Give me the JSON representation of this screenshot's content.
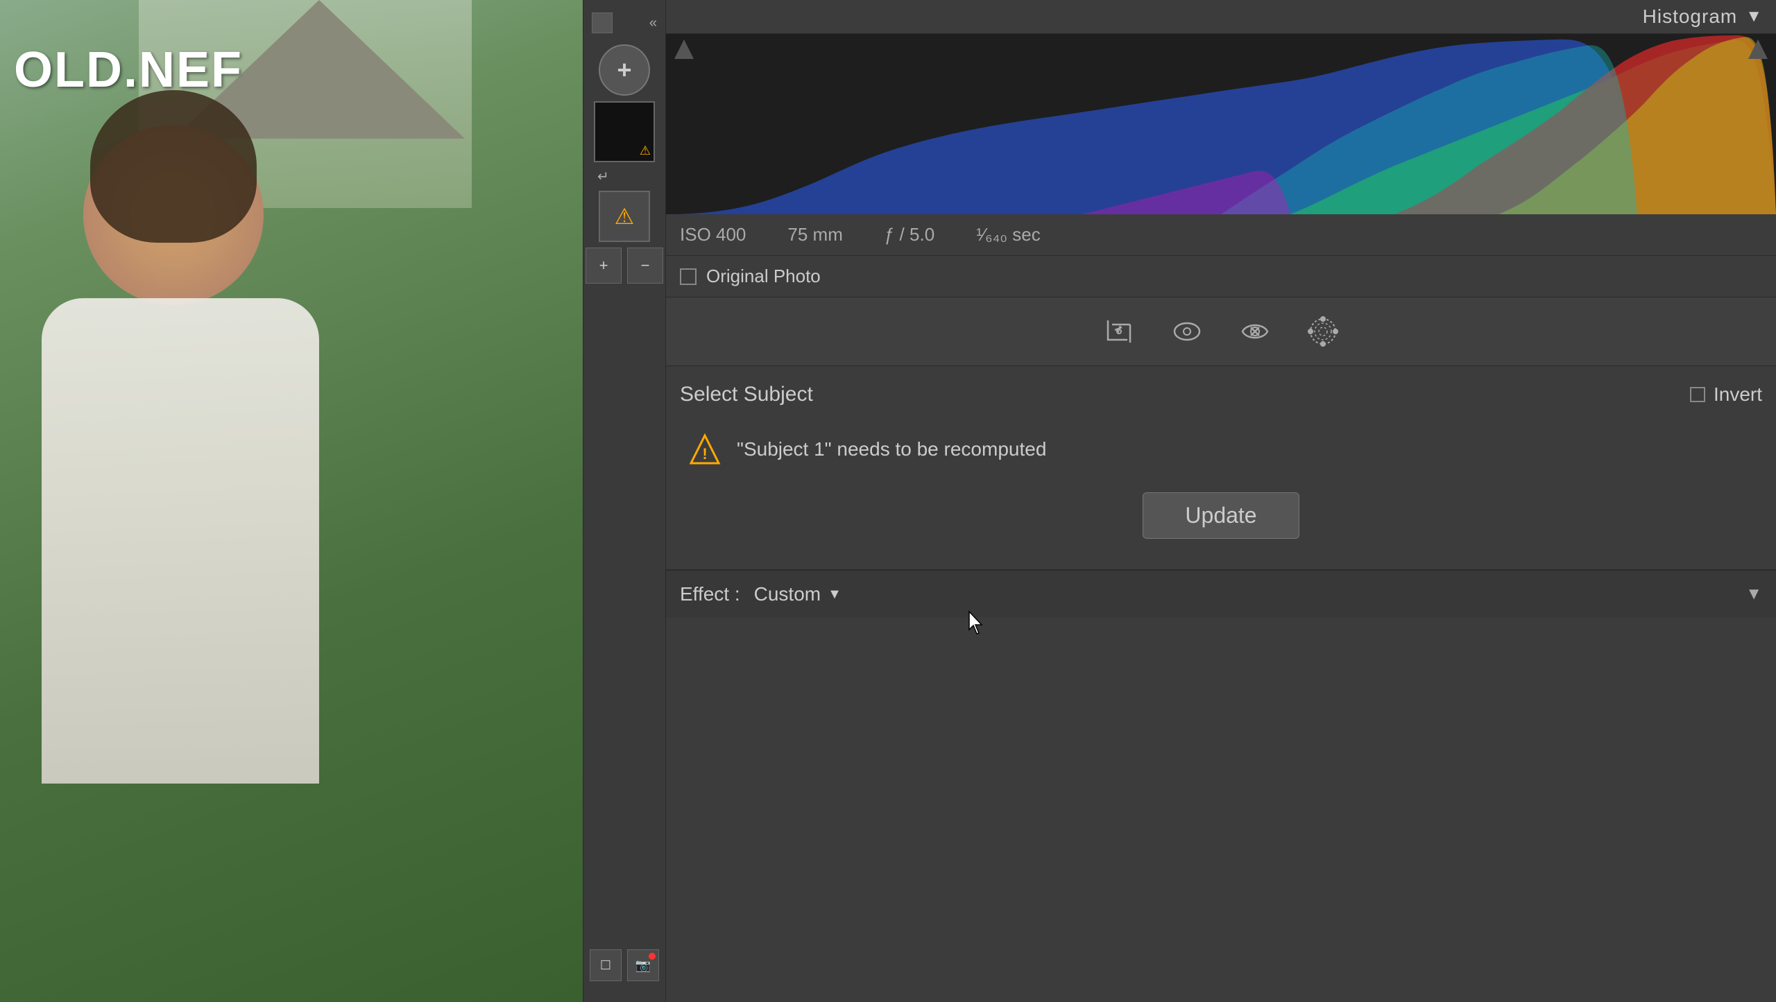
{
  "filename": "OLD.NEF",
  "toolbar": {
    "add_label": "+",
    "back_chevrons": "«"
  },
  "histogram": {
    "title": "Histogram",
    "dropdown_arrow": "▼"
  },
  "camera_info": {
    "iso": "ISO 400",
    "focal_length": "75 mm",
    "aperture": "ƒ / 5.0",
    "shutter": "¹⁄₆₄₀ sec"
  },
  "original_photo": {
    "label": "Original Photo"
  },
  "select_subject": {
    "title": "Select Subject",
    "invert_label": "Invert",
    "warning_text": "\"Subject 1\" needs to be recomputed",
    "update_btn": "Update"
  },
  "effect": {
    "label": "Effect :",
    "value": "Custom"
  }
}
